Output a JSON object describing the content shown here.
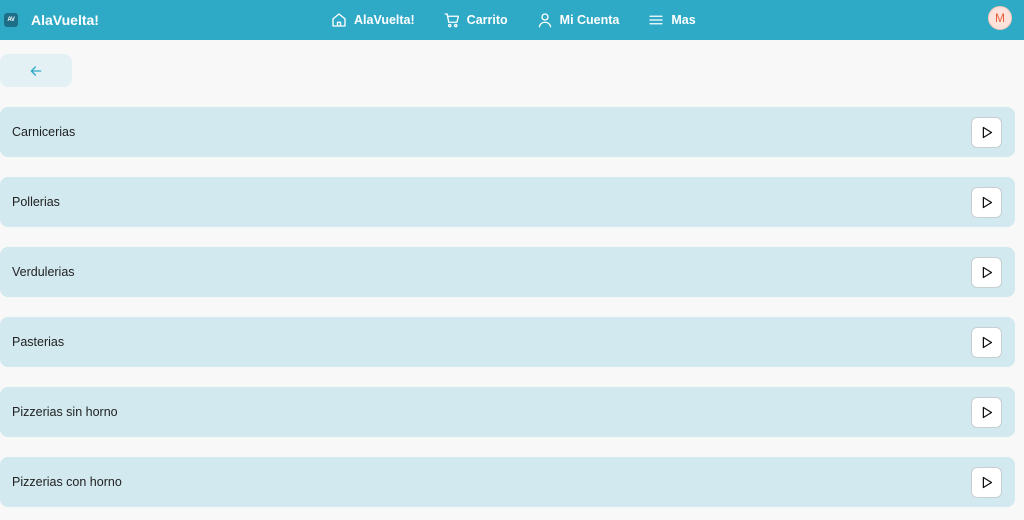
{
  "header": {
    "logo_text": "AV",
    "brand": "AlaVuelta!",
    "nav": [
      {
        "label": "AlaVuelta!",
        "icon": "home-icon"
      },
      {
        "label": "Carrito",
        "icon": "cart-icon"
      },
      {
        "label": "Mi Cuenta",
        "icon": "user-icon"
      },
      {
        "label": "Mas",
        "icon": "menu-icon"
      }
    ],
    "avatar_initial": "M"
  },
  "back_button": {
    "icon": "arrow-left-icon"
  },
  "categories": [
    {
      "label": "Carnicerias",
      "icon": "play-icon"
    },
    {
      "label": "Pollerias",
      "icon": "play-icon"
    },
    {
      "label": "Verdulerias",
      "icon": "play-icon"
    },
    {
      "label": "Pasterias",
      "icon": "play-icon"
    },
    {
      "label": "Pizzerias sin horno",
      "icon": "play-icon"
    },
    {
      "label": "Pizzerias con horno",
      "icon": "play-icon"
    }
  ],
  "colors": {
    "header": "#2ea9c6",
    "row_bg": "#d1e9ef",
    "back_bg": "#e3f1f5",
    "avatar_bg": "#fde3dc",
    "avatar_text": "#e45d3d"
  }
}
